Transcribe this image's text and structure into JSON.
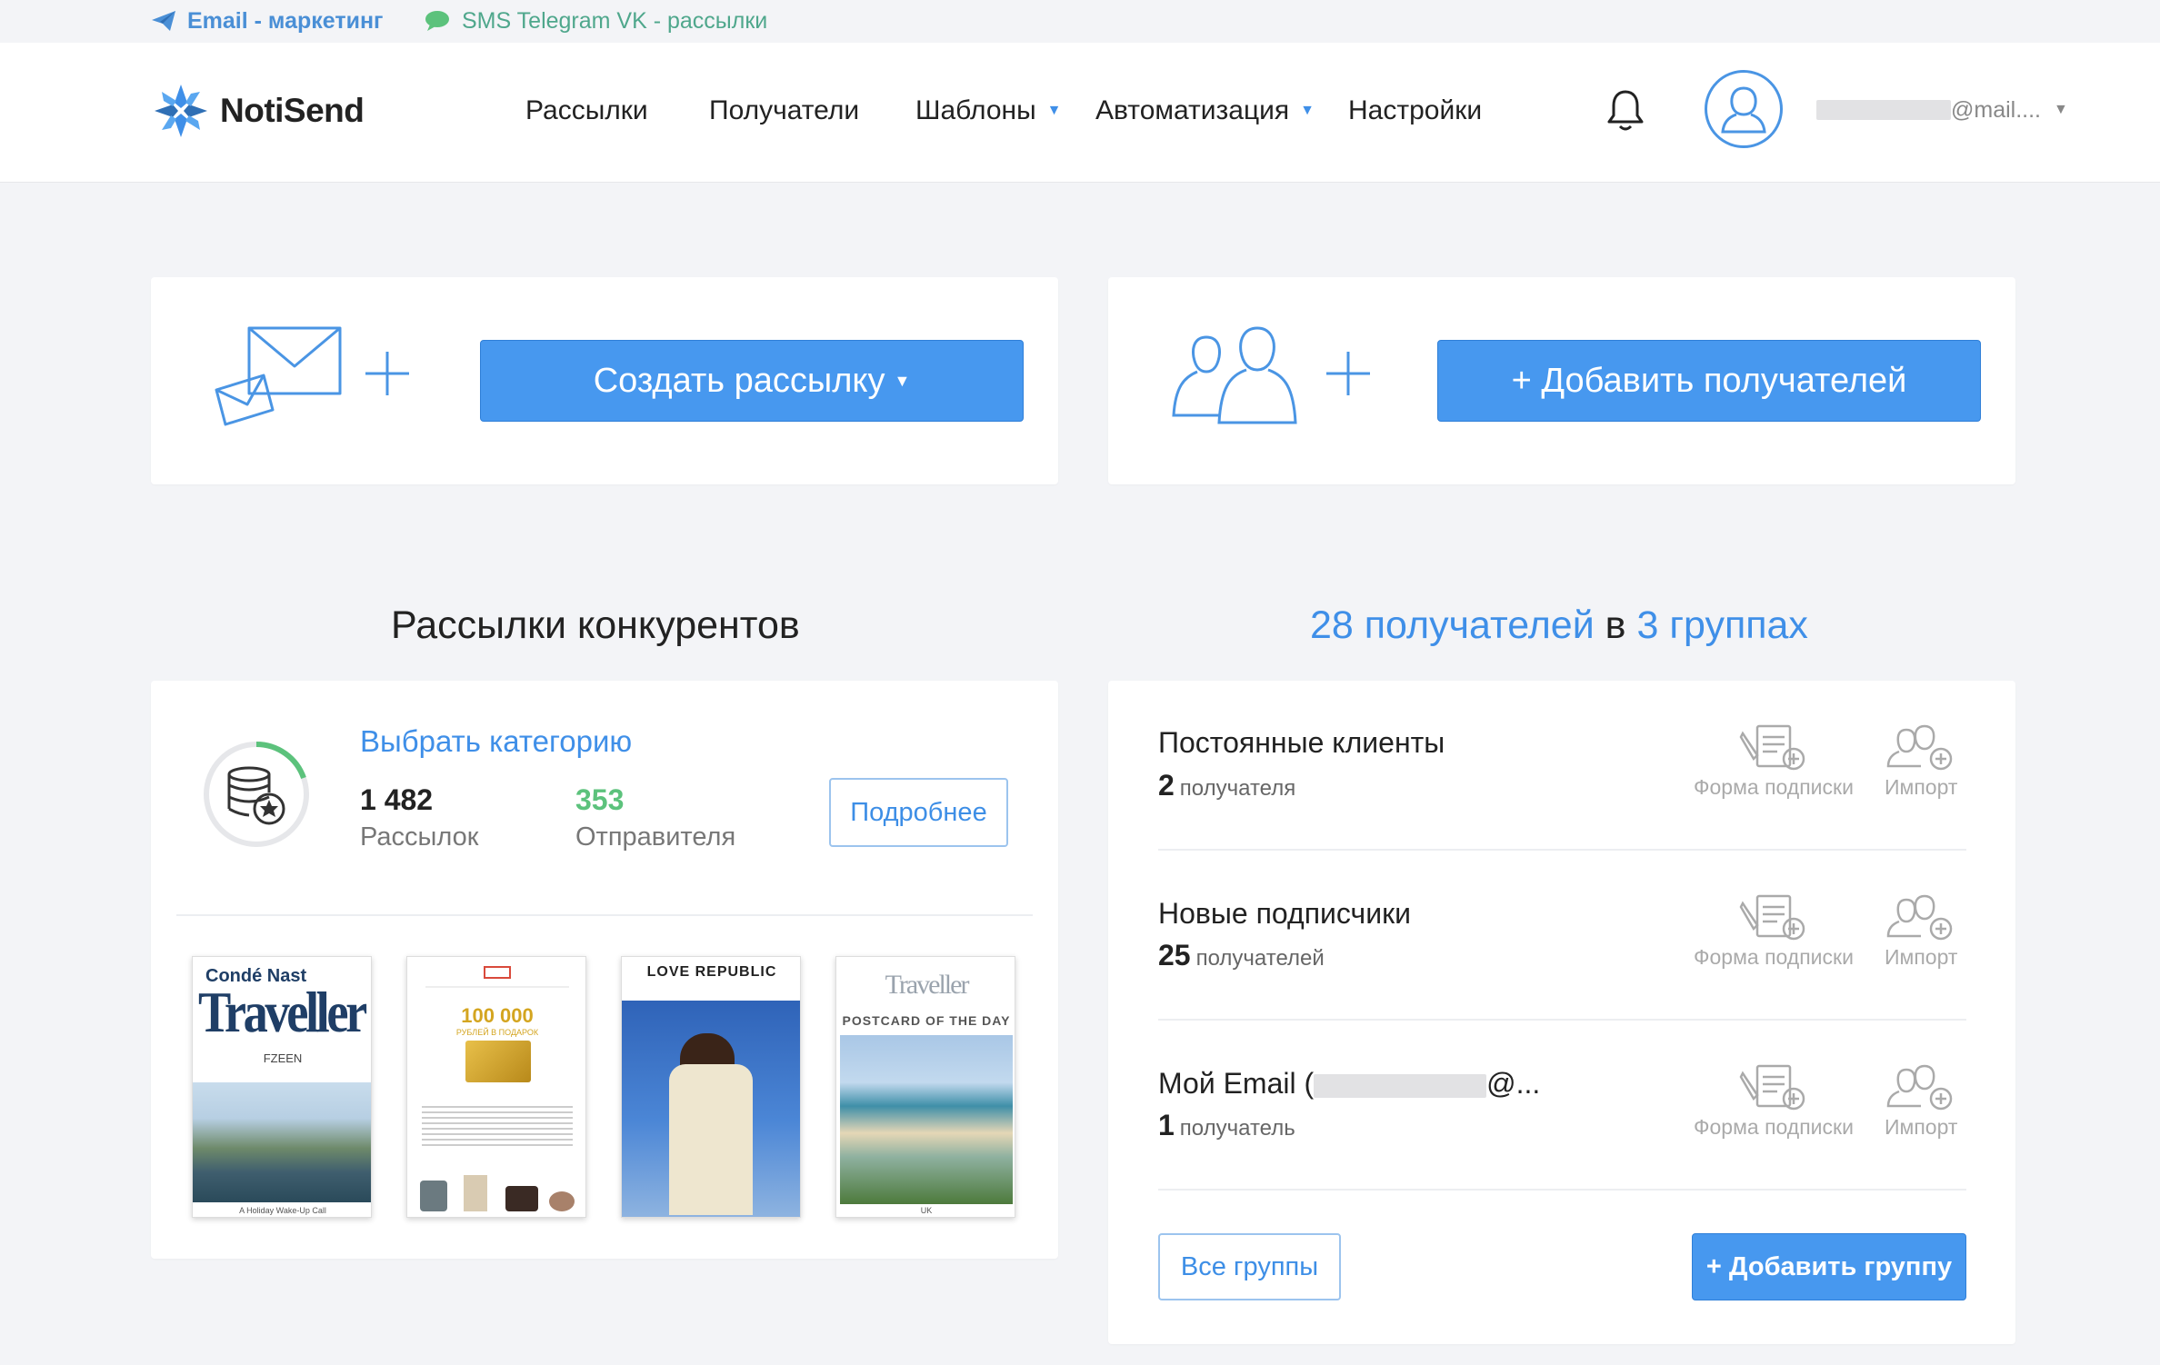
{
  "topbar": {
    "email_link": "Email - маркетинг",
    "sms_link": "SMS Telegram VK - рассылки"
  },
  "header": {
    "logo_text": "NotiSend",
    "nav": [
      {
        "label": "Рассылки",
        "dropdown": false
      },
      {
        "label": "Получатели",
        "dropdown": false
      },
      {
        "label": "Шаблоны",
        "dropdown": true
      },
      {
        "label": "Автоматизация",
        "dropdown": true
      },
      {
        "label": "Настройки",
        "dropdown": false
      }
    ],
    "account_suffix": "@mail...."
  },
  "actions": {
    "create_campaign": "Создать рассылку",
    "add_recipients": "+ Добавить получателей"
  },
  "competitors": {
    "title": "Рассылки конкурентов",
    "choose_category": "Выбрать категорию",
    "campaigns_count": "1 482",
    "campaigns_label": "Рассылок",
    "senders_count": "353",
    "senders_label": "Отправителя",
    "more_button": "Подробнее",
    "thumbnails": [
      {
        "brand": "Condé Nast",
        "title": "Traveller",
        "sub": "FZEEN",
        "caption": "A Holiday Wake-Up Call"
      },
      {
        "headline": "100 000",
        "sub": "РУБЛЕЙ В ПОДАРОК"
      },
      {
        "brand": "LOVE REPUBLIC"
      },
      {
        "brand": "Traveller",
        "title": "POSTCARD OF THE DAY",
        "caption": "UK"
      }
    ]
  },
  "groups": {
    "summary_count": "28 получателей",
    "summary_in": "в",
    "summary_groups": "3 группах",
    "items": [
      {
        "name": "Постоянные клиенты",
        "count": "2",
        "unit": "получателя"
      },
      {
        "name": "Новые подписчики",
        "count": "25",
        "unit": "получателей"
      },
      {
        "name": "Мой Email (",
        "name_tail": "@...",
        "count": "1",
        "unit": "получатель"
      }
    ],
    "subscribe_form_label": "Форма подписки",
    "import_label": "Импорт",
    "all_groups_button": "Все группы",
    "add_group_button": "+ Добавить группу"
  },
  "colors": {
    "accent": "#4798ef",
    "link": "#3f8fe8",
    "green": "#5cc27c",
    "background": "#f3f4f7"
  }
}
